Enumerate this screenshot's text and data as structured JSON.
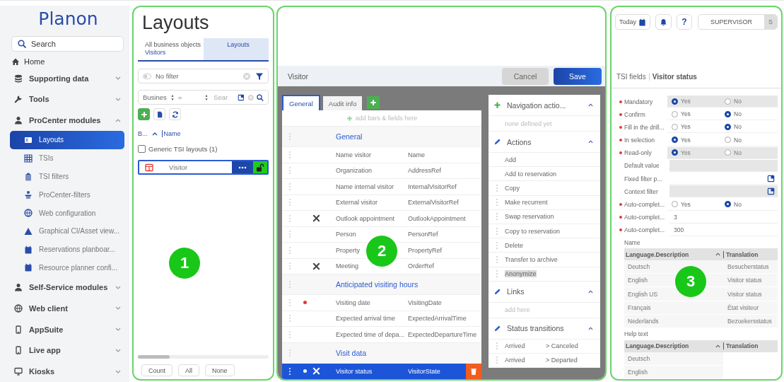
{
  "sidebar": {
    "logo": "Planon",
    "search": {
      "placeholder": "Search"
    },
    "home": "Home",
    "items": [
      {
        "label": "Supporting data",
        "expanded": false
      },
      {
        "label": "Tools",
        "expanded": false
      },
      {
        "label": "ProCenter modules",
        "expanded": true,
        "children": [
          {
            "label": "Layouts",
            "selected": true
          },
          {
            "label": "TSIs",
            "selected": false
          },
          {
            "label": "TSI filters",
            "selected": false
          },
          {
            "label": "ProCenter-filters",
            "selected": false
          },
          {
            "label": "Web configuration",
            "selected": false
          },
          {
            "label": "Graphical CI/Asset view...",
            "selected": false
          },
          {
            "label": "Reservations planboar...",
            "selected": false
          },
          {
            "label": "Resource planner confi...",
            "selected": false
          }
        ]
      },
      {
        "label": "Self-Service modules",
        "expanded": false
      },
      {
        "label": "Web client",
        "expanded": false
      },
      {
        "label": "AppSuite",
        "expanded": false
      },
      {
        "label": "Live app",
        "expanded": false
      },
      {
        "label": "Kiosks",
        "expanded": false
      }
    ]
  },
  "layouts_panel": {
    "title": "Layouts",
    "tabs": [
      {
        "label": "All business objects",
        "sublabel": "Visitors",
        "selected": false
      },
      {
        "label": "Layouts",
        "selected": true
      }
    ],
    "filter": "No filter",
    "search_row": {
      "field": "Busines",
      "operator": "=",
      "placeholder": "Sear"
    },
    "columns": [
      "B...",
      "Name"
    ],
    "group": {
      "label": "Generic TSI layouts (1)",
      "checked": false
    },
    "rows": [
      {
        "label": "Visitor",
        "selected": true
      }
    ],
    "footer_buttons": [
      "Count",
      "All",
      "None"
    ],
    "badge": "1"
  },
  "editor": {
    "title": "Visitor",
    "buttons": [
      {
        "label": "Cancel",
        "kind": "secondary"
      },
      {
        "label": "Save",
        "kind": "primary"
      }
    ],
    "tabs": [
      {
        "label": "General",
        "selected": true
      },
      {
        "label": "Audit info",
        "selected": false
      }
    ],
    "hint": "add bars & fields here",
    "rows": [
      {
        "kind": "section",
        "label": "General"
      },
      {
        "kind": "field",
        "label": "Name visitor",
        "field": "Name",
        "required": false,
        "special": false,
        "selected": false
      },
      {
        "kind": "field",
        "label": "Organization",
        "field": "AddressRef",
        "required": false,
        "special": false,
        "selected": false
      },
      {
        "kind": "field",
        "label": "Name internal visitor",
        "field": "InternalVisitorRef",
        "required": false,
        "special": false,
        "selected": false
      },
      {
        "kind": "field",
        "label": "External visitor",
        "field": "ExternalVisitorRef",
        "required": false,
        "special": false,
        "selected": false
      },
      {
        "kind": "field",
        "label": "Outlook appointment",
        "field": "OutlookAppointment",
        "required": false,
        "special": true,
        "selected": false
      },
      {
        "kind": "field",
        "label": "Person",
        "field": "PersonRef",
        "required": false,
        "special": false,
        "selected": false
      },
      {
        "kind": "field",
        "label": "Property",
        "field": "PropertyRef",
        "required": false,
        "special": false,
        "selected": false
      },
      {
        "kind": "field",
        "label": "Meeting",
        "field": "OrderRef",
        "required": false,
        "special": true,
        "selected": false
      },
      {
        "kind": "section",
        "label": "Anticipated visiting hours"
      },
      {
        "kind": "field",
        "label": "Visiting date",
        "field": "VisitingDate",
        "required": true,
        "special": false,
        "selected": false
      },
      {
        "kind": "field",
        "label": "Expected arrival time",
        "field": "ExpectedArrivalTime",
        "required": false,
        "special": false,
        "selected": false
      },
      {
        "kind": "field",
        "label": "Expected time of depa...",
        "field": "ExpectedDepartureTime",
        "required": false,
        "special": false,
        "selected": false
      },
      {
        "kind": "section",
        "label": "Visit data"
      },
      {
        "kind": "field",
        "label": "Visitor status",
        "field": "VisitorState",
        "required": true,
        "special": true,
        "selected": true
      }
    ],
    "side_sections": [
      {
        "kind": "add",
        "title": "Navigation actio...",
        "expanded": true,
        "empty_hint": "none defined yet"
      },
      {
        "kind": "edit",
        "title": "Actions",
        "expanded": true,
        "items": [
          {
            "label": "Add",
            "draggable": false,
            "highlighted": false
          },
          {
            "label": "Add to reservation",
            "draggable": false,
            "highlighted": false
          },
          {
            "label": "Copy",
            "draggable": true,
            "highlighted": false
          },
          {
            "label": "Make recurrent",
            "draggable": true,
            "highlighted": false
          },
          {
            "label": "Swap reservation",
            "draggable": true,
            "highlighted": false
          },
          {
            "label": "Copy to reservation",
            "draggable": true,
            "highlighted": false
          },
          {
            "label": "Delete",
            "draggable": true,
            "highlighted": false
          },
          {
            "label": "Transfer to archive",
            "draggable": true,
            "highlighted": false
          },
          {
            "label": "Anonymize",
            "draggable": true,
            "highlighted": true
          }
        ]
      },
      {
        "kind": "edit",
        "title": "Links",
        "expanded": true,
        "empty_hint": "add here"
      },
      {
        "kind": "edit",
        "title": "Status transitions",
        "expanded": true,
        "items": [
          {
            "label": "Arrived",
            "target": "> Canceled",
            "draggable": true,
            "highlighted": false
          },
          {
            "label": "Arrived",
            "target": "> Departed",
            "draggable": true,
            "highlighted": false
          }
        ]
      }
    ],
    "badge": "2"
  },
  "props": {
    "toolbar": {
      "today": "Today",
      "help": "?",
      "user": "SUPERVISOR",
      "avatar": "S"
    },
    "breadcrumb": [
      "TSI fields",
      "Visitor status"
    ],
    "fields": [
      {
        "kind": "radio",
        "label": "Mandatory",
        "required": true,
        "disabled": true,
        "options": [
          {
            "label": "Yes",
            "selected": true
          },
          {
            "label": "No",
            "selected": false
          }
        ]
      },
      {
        "kind": "radio",
        "label": "Confirm",
        "required": true,
        "disabled": false,
        "options": [
          {
            "label": "Yes",
            "selected": false
          },
          {
            "label": "No",
            "selected": true
          }
        ]
      },
      {
        "kind": "radio",
        "label": "Fill in the drill...",
        "required": true,
        "disabled": false,
        "options": [
          {
            "label": "Yes",
            "selected": false
          },
          {
            "label": "No",
            "selected": true
          }
        ]
      },
      {
        "kind": "radio",
        "label": "In selection",
        "required": true,
        "disabled": false,
        "options": [
          {
            "label": "Yes",
            "selected": true
          },
          {
            "label": "No",
            "selected": false
          }
        ]
      },
      {
        "kind": "radio",
        "label": "Read-only",
        "required": true,
        "disabled": true,
        "options": [
          {
            "label": "Yes",
            "selected": true
          },
          {
            "label": "No",
            "selected": false
          }
        ]
      },
      {
        "kind": "text",
        "label": "Default value",
        "required": false,
        "disabled": true
      },
      {
        "kind": "lookup",
        "label": "Fixed filter p...",
        "required": false,
        "disabled": false
      },
      {
        "kind": "lookup",
        "label": "Context filter",
        "required": false,
        "disabled": true
      },
      {
        "kind": "radio",
        "label": "Auto-complet...",
        "required": true,
        "disabled": false,
        "options": [
          {
            "label": "Yes",
            "selected": false
          },
          {
            "label": "No",
            "selected": true
          }
        ]
      },
      {
        "kind": "text",
        "label": "Auto-complet...",
        "required": true,
        "disabled": false,
        "value": "3"
      },
      {
        "kind": "text",
        "label": "Auto-complet...",
        "required": true,
        "disabled": false,
        "value": "300"
      }
    ],
    "tables": [
      {
        "title": "Name",
        "columns": [
          "Language.Description",
          "Translation"
        ],
        "rows": [
          [
            "Deutsch",
            "Besucherstatus"
          ],
          [
            "English",
            "Visitor status"
          ],
          [
            "English US",
            "Visitor status"
          ],
          [
            "Français",
            "État visiteur"
          ],
          [
            "Nederlands",
            "Bezoekersstatus"
          ]
        ]
      },
      {
        "title": "Help text",
        "columns": [
          "Language.Description",
          "Translation"
        ],
        "rows": [
          [
            "Deutsch"
          ],
          [
            "English"
          ]
        ]
      }
    ],
    "badge": "3"
  }
}
